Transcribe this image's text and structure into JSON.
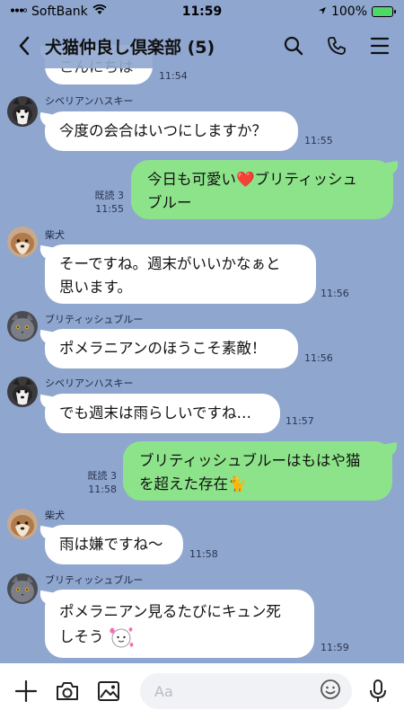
{
  "status": {
    "carrier": "SoftBank",
    "time": "11:59",
    "battery": "100%"
  },
  "header": {
    "title": "犬猫仲良し倶楽部 (5)"
  },
  "messages": {
    "m0": {
      "text": "こんにちは",
      "time": "11:54"
    },
    "m1": {
      "sender": "シベリアンハスキー",
      "text": "今度の会合はいつにしますか？",
      "time": "11:55"
    },
    "m2": {
      "line1": "今日も可愛い",
      "emoji": "❤️",
      "line1b": "ブリティッシュ",
      "line2": "ブルー",
      "read": "既読 3",
      "time": "11:55"
    },
    "m3": {
      "sender": "柴犬",
      "line1": "そーですね。週末がいいかなぁと",
      "line2": "思います。",
      "time": "11:56"
    },
    "m4": {
      "sender": "ブリティッシュブルー",
      "text": "ポメラニアンのほうこそ素敵！",
      "time": "11:56"
    },
    "m5": {
      "sender": "シベリアンハスキー",
      "text": "でも週末は雨らしいですね…",
      "time": "11:57"
    },
    "m6": {
      "line1": "ブリティッシュブルーはもはや猫",
      "line2": "を超えた存在",
      "emoji": "🐈",
      "read": "既読 3",
      "time": "11:58"
    },
    "m7": {
      "sender": "柴犬",
      "text": "雨は嫌ですね〜",
      "time": "11:58"
    },
    "m8": {
      "sender": "ブリティッシュブルー",
      "line1": "ポメラニアン見るたびにキュン死",
      "line2": "しそう",
      "time": "11:59"
    }
  },
  "input": {
    "placeholder": "Aa"
  }
}
